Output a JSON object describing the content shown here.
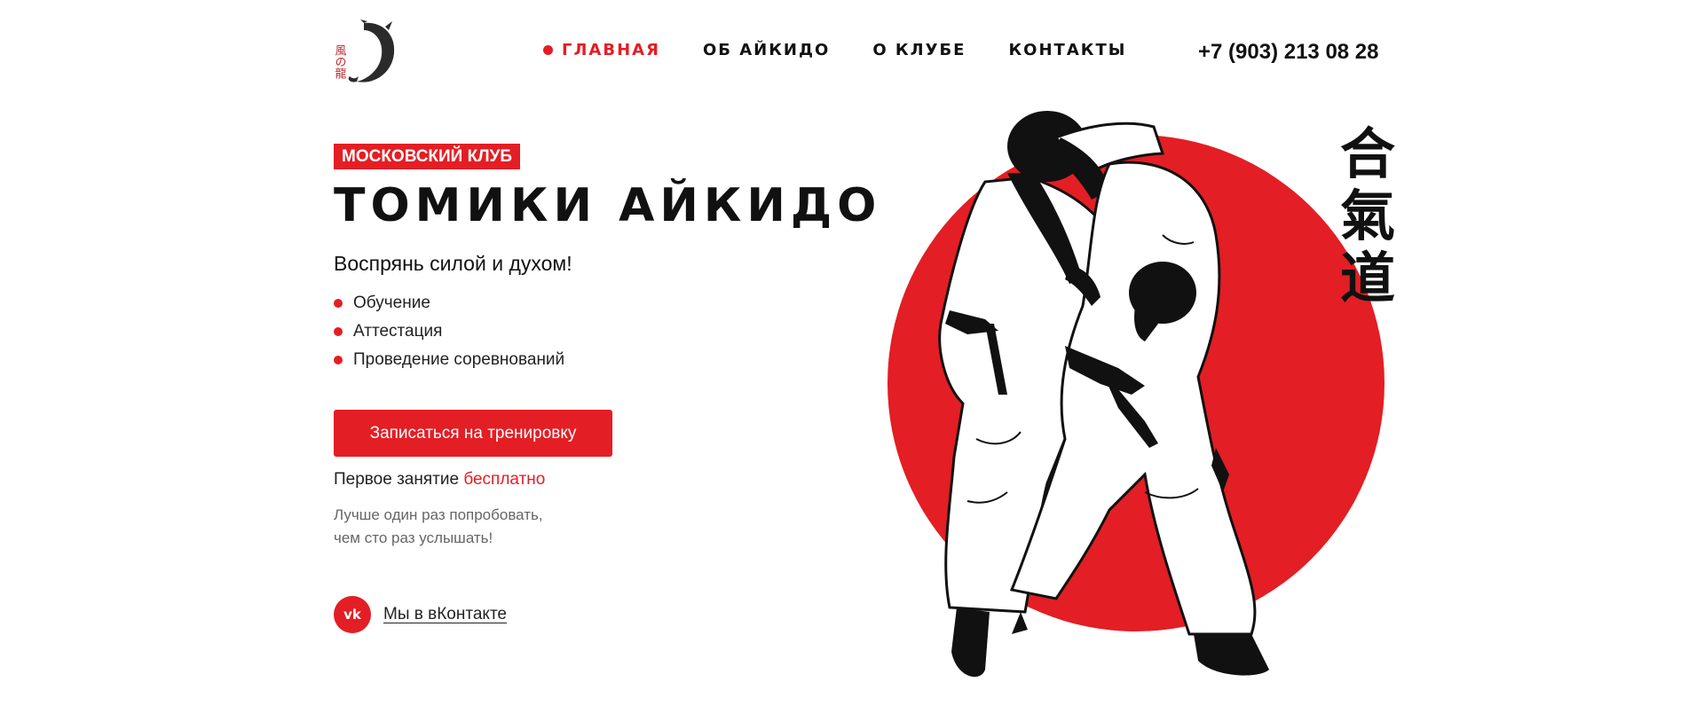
{
  "logo": {
    "icon": "dragon-logo-icon",
    "glyphs": "風の龍"
  },
  "nav": {
    "items": [
      {
        "label": "ГЛАВНАЯ",
        "active": true
      },
      {
        "label": "ОБ АЙКИДО",
        "active": false
      },
      {
        "label": "О КЛУБЕ",
        "active": false
      },
      {
        "label": "КОНТАКТЫ",
        "active": false
      }
    ]
  },
  "header": {
    "phone": "+7 (903) 213 08 28"
  },
  "hero": {
    "badge": "МОСКОВСКИЙ КЛУБ",
    "title": "ТОМИКИ АЙКИДО",
    "subtitle": "Воспрянь силой и духом!",
    "features": [
      "Обучение",
      "Аттестация",
      "Проведение соревнований"
    ],
    "cta_label": "Записаться на тренировку",
    "free_note_prefix": "Первое занятие",
    "free_note_accent": "бесплатно",
    "quote_line1": "Лучше один раз попробовать,",
    "quote_line2": "чем сто раз услышать!",
    "kanji": [
      "合",
      "氣",
      "道"
    ]
  },
  "social": {
    "vk_icon_text": "vk",
    "vk_label": "Мы в вКонтакте"
  },
  "colors": {
    "accent": "#e31e24",
    "text": "#111111",
    "muted": "#666666"
  }
}
